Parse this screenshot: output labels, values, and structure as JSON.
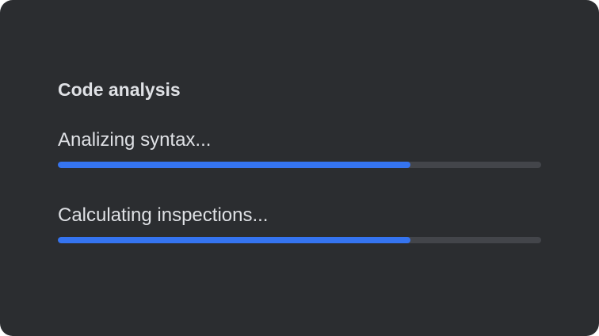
{
  "dialog": {
    "title": "Code analysis",
    "tasks": [
      {
        "label": "Analizing syntax...",
        "progress": 0.73
      },
      {
        "label": "Calculating inspections...",
        "progress": 0.73
      }
    ]
  },
  "colors": {
    "background": "#2b2d30",
    "text": "#dfe1e5",
    "track": "#43454a",
    "accent": "#3574f0"
  }
}
